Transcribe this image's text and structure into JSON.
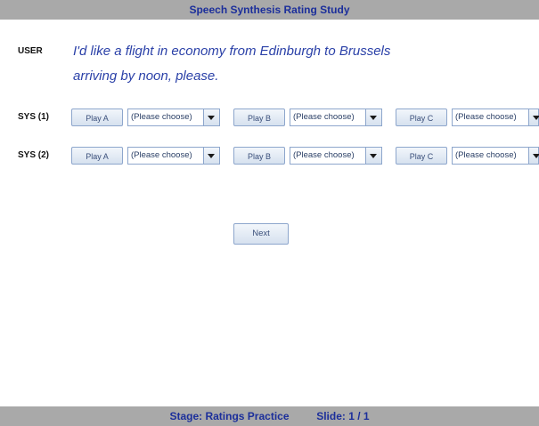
{
  "header": {
    "title": "Speech Synthesis Rating Study"
  },
  "user": {
    "label": "USER",
    "utterance_line1": "I'd like a flight in economy from Edinburgh to Brussels",
    "utterance_line2": "arriving by noon, please."
  },
  "rows": [
    {
      "label": "SYS (1)",
      "options": [
        {
          "play_label": "Play A",
          "select_value": "(Please choose)"
        },
        {
          "play_label": "Play B",
          "select_value": "(Please choose)"
        },
        {
          "play_label": "Play C",
          "select_value": "(Please choose)"
        }
      ]
    },
    {
      "label": "SYS (2)",
      "options": [
        {
          "play_label": "Play A",
          "select_value": "(Please choose)"
        },
        {
          "play_label": "Play B",
          "select_value": "(Please choose)"
        },
        {
          "play_label": "Play C",
          "select_value": "(Please choose)"
        }
      ]
    }
  ],
  "next_label": "Next",
  "footer": {
    "stage": "Stage:  Ratings Practice",
    "slide": "Slide:  1 / 1"
  },
  "colors": {
    "bar_bg": "#a9a9a9",
    "bar_text": "#1c2f9b",
    "utterance_text": "#2b41a8",
    "button_border": "#8da6cc"
  }
}
